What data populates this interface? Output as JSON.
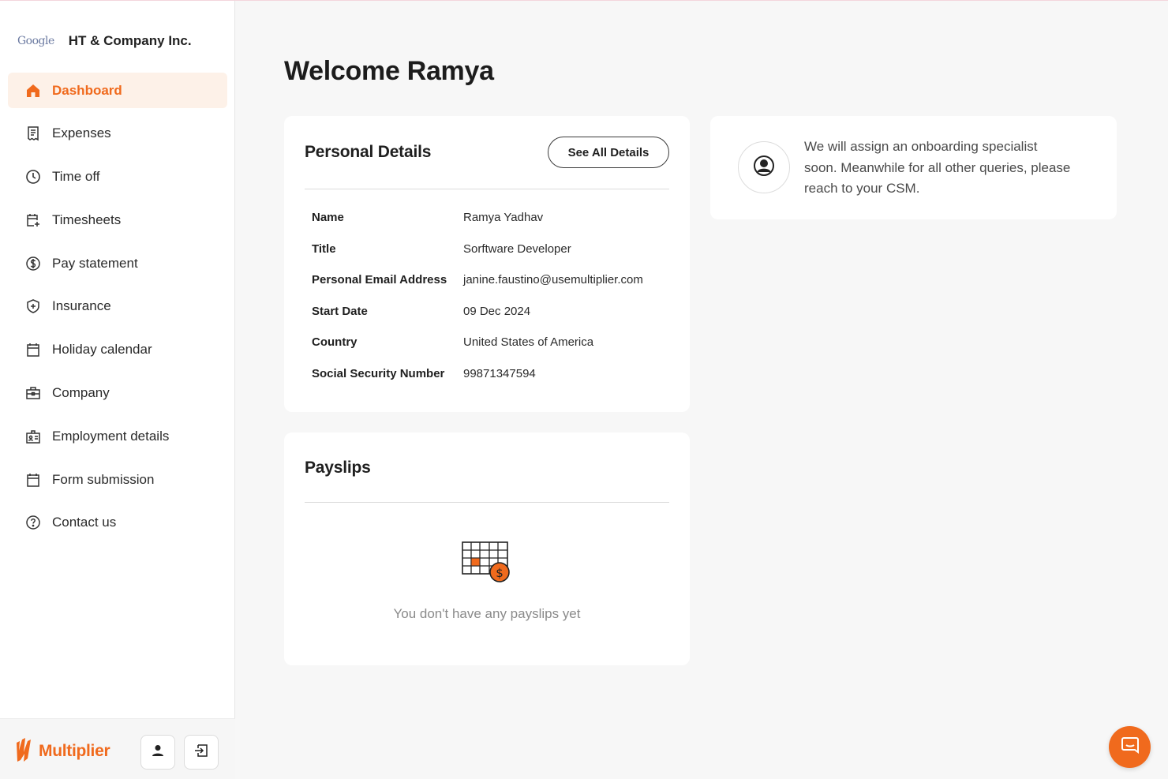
{
  "company": {
    "logo_text": "Google",
    "name": "HT & Company Inc."
  },
  "nav": [
    {
      "label": "Dashboard",
      "icon": "home-icon",
      "active": true
    },
    {
      "label": "Expenses",
      "icon": "receipt-icon"
    },
    {
      "label": "Time off",
      "icon": "clock-icon"
    },
    {
      "label": "Timesheets",
      "icon": "calendar-plus-icon"
    },
    {
      "label": "Pay statement",
      "icon": "dollar-circle-icon"
    },
    {
      "label": "Insurance",
      "icon": "shield-plus-icon"
    },
    {
      "label": "Holiday calendar",
      "icon": "calendar-icon"
    },
    {
      "label": "Company",
      "icon": "briefcase-icon"
    },
    {
      "label": "Employment details",
      "icon": "id-badge-icon"
    },
    {
      "label": "Form submission",
      "icon": "calendar-form-icon"
    },
    {
      "label": "Contact us",
      "icon": "help-circle-icon"
    }
  ],
  "footer": {
    "brand_name": "Multiplier"
  },
  "main": {
    "welcome": "Welcome Ramya",
    "personal_details": {
      "title": "Personal Details",
      "see_all_label": "See All Details",
      "rows": [
        {
          "label": "Name",
          "value": "Ramya Yadhav"
        },
        {
          "label": "Title",
          "value": "Sorftware Developer"
        },
        {
          "label": "Personal Email Address",
          "value": "janine.faustino@usemultiplier.com"
        },
        {
          "label": "Start Date",
          "value": "09 Dec 2024"
        },
        {
          "label": "Country",
          "value": "United States of America"
        },
        {
          "label": "Social Security Number",
          "value": "99871347594"
        }
      ]
    },
    "payslips": {
      "title": "Payslips",
      "empty_text": "You don't have any payslips yet"
    },
    "info": {
      "text": "We will assign an onboarding specialist soon. Meanwhile for all other queries, please reach to your CSM."
    }
  },
  "colors": {
    "accent": "#f06a1d",
    "active_bg": "#fdf1e8"
  }
}
